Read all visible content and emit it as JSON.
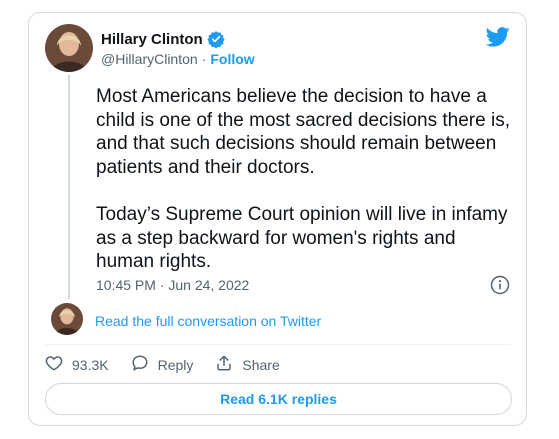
{
  "author": {
    "name": "Hillary Clinton",
    "handle": "@HillaryClinton",
    "separator": "·",
    "follow_label": "Follow"
  },
  "tweet": {
    "paragraph1": "Most Americans believe the decision to have a child is one of the most sacred decisions there is, and that such decisions should remain between patients and their doctors.",
    "paragraph2": "Today’s Supreme Court opinion will live in infamy as a step backward for women's rights and human rights.",
    "timestamp": "10:45 PM · Jun 24, 2022"
  },
  "conversation": {
    "link_label": "Read the full conversation on Twitter"
  },
  "actions": {
    "likes_count": "93.3K",
    "reply_label": "Reply",
    "share_label": "Share"
  },
  "replies_button": {
    "label": "Read 6.1K replies"
  },
  "colors": {
    "accent": "#1d9bf0",
    "text": "#0f1419",
    "secondary": "#536471",
    "border": "#cfd9de"
  },
  "icons": {
    "verified": "verified-badge-icon",
    "logo": "twitter-bird-icon",
    "info": "info-icon",
    "like": "heart-icon",
    "reply": "speech-bubble-icon",
    "share": "share-upload-icon"
  }
}
